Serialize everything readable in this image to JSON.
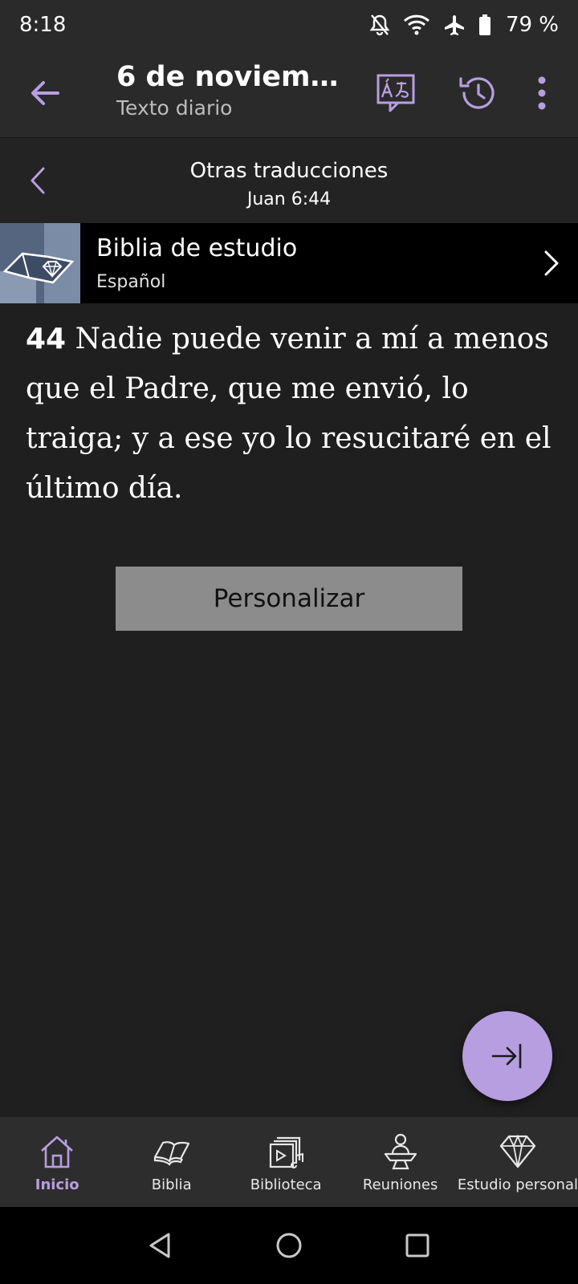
{
  "status_bar": {
    "time": "8:18",
    "battery": "79 %"
  },
  "app_bar": {
    "title": "6 de noviembr…",
    "subtitle": "Texto diario"
  },
  "sub_header": {
    "title": "Otras traducciones",
    "reference": "Juan 6:44"
  },
  "publication": {
    "title": "Biblia de estudio",
    "language": "Español"
  },
  "verse": {
    "number": "44",
    "text": "Nadie puede venir a mí a menos que el Padre, que me envió, lo traiga; y a ese yo lo resucitaré en el último día."
  },
  "customize_button": {
    "label": "Personalizar"
  },
  "bottom_nav": [
    {
      "label": "Inicio",
      "icon": "home-icon",
      "active": true
    },
    {
      "label": "Biblia",
      "icon": "bible-icon",
      "active": false
    },
    {
      "label": "Biblioteca",
      "icon": "library-icon",
      "active": false
    },
    {
      "label": "Reuniones",
      "icon": "meetings-icon",
      "active": false
    },
    {
      "label": "Estudio personal",
      "icon": "diamond-icon",
      "active": false
    }
  ],
  "colors": {
    "accent": "#b79ee0",
    "background": "#1f1f1f",
    "button": "#8c8c8c"
  }
}
